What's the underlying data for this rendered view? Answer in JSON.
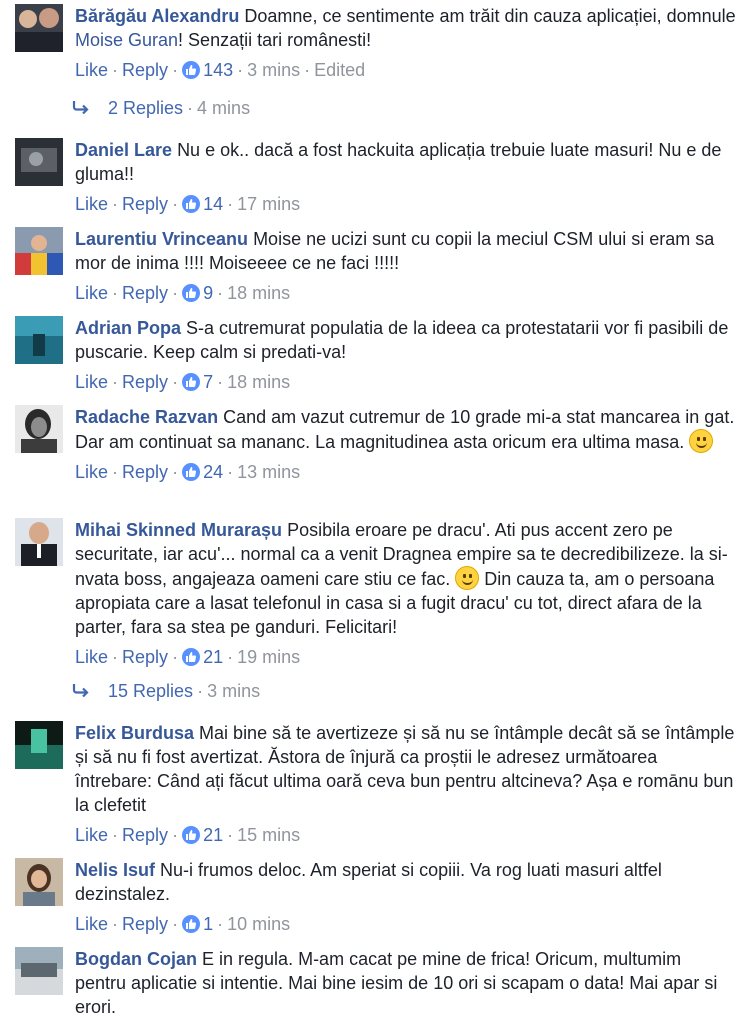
{
  "colors": {
    "link": "#365899",
    "like_badge": "#5890ff",
    "muted": "#90949c"
  },
  "actions": {
    "like": "Like",
    "reply": "Reply",
    "dot": "·"
  },
  "comments": [
    {
      "author": "Bărăgău Alexandru",
      "text_before": "Doamne, ce sentimente am trăit din cauza aplicației, domnule ",
      "mention": "Moise Guran",
      "text_after": "! Senzații tari românesti!",
      "likes": "143",
      "time": "3 mins",
      "edited": "Edited",
      "replies": {
        "label": "2 Replies",
        "time": "4 mins"
      }
    },
    {
      "author": "Daniel Lare",
      "text": "Nu e ok.. dacă a fost hackuita aplicația trebuie luate masuri! Nu e de gluma!!",
      "likes": "14",
      "time": "17 mins"
    },
    {
      "author": "Laurentiu Vrinceanu",
      "text": "Moise ne ucizi sunt cu copii la meciul CSM ului si eram sa mor de inima !!!! Moiseeee ce ne faci !!!!!",
      "likes": "9",
      "time": "18 mins"
    },
    {
      "author": "Adrian Popa",
      "text": "S-a cutremurat populatia de la ideea ca protestatarii vor fi pasibili de puscarie. Keep calm si predati-va!",
      "likes": "7",
      "time": "18 mins"
    },
    {
      "author": "Radache Razvan",
      "text": "Cand am vazut cutremur de 10 grade mi-a stat mancarea in gat. Dar am continuat sa mananc. La magnitudinea asta oricum era ultima masa.",
      "likes": "24",
      "time": "13 mins"
    },
    {
      "author": "Mihai Skinned Murarașu",
      "text_before": "Posibila eroare pe dracu'. Ati pus accent zero pe securitate, iar acu'... normal ca a venit Dragnea empire sa te decredibilizeze. la si-nvata boss, angajeaza oameni care stiu ce fac.",
      "text_after": "Din cauza ta, am o persoana apropiata care a lasat telefonul in casa si a fugit dracu' cu tot, direct afara de la parter, fara sa stea pe ganduri. Felicitari!",
      "likes": "21",
      "time": "19 mins",
      "replies": {
        "label": "15 Replies",
        "time": "3 mins"
      }
    },
    {
      "author": "Felix Burdusa",
      "text": "Mai bine să te avertizeze și să nu se întâmple decât să se întâmple și să nu fi fost avertizat. Ăstora de înjură ca proștii le adresez următoarea întrebare: Când ați făcut ultima oară ceva bun pentru altcineva? Așa e romānu bun la clefetit",
      "likes": "21",
      "time": "15 mins"
    },
    {
      "author": "Nelis Isuf",
      "text": "Nu-i frumos deloc. Am speriat si copiii. Va rog luati masuri altfel dezinstalez.",
      "likes": "1",
      "time": "10 mins"
    },
    {
      "author": "Bogdan Cojan",
      "text": "E in regula. M-am cacat pe mine de frica! Oricum, multumim pentru aplicatie si intentie. Mai bine iesim de 10 ori si scapam o data! Mai apar si erori."
    }
  ]
}
